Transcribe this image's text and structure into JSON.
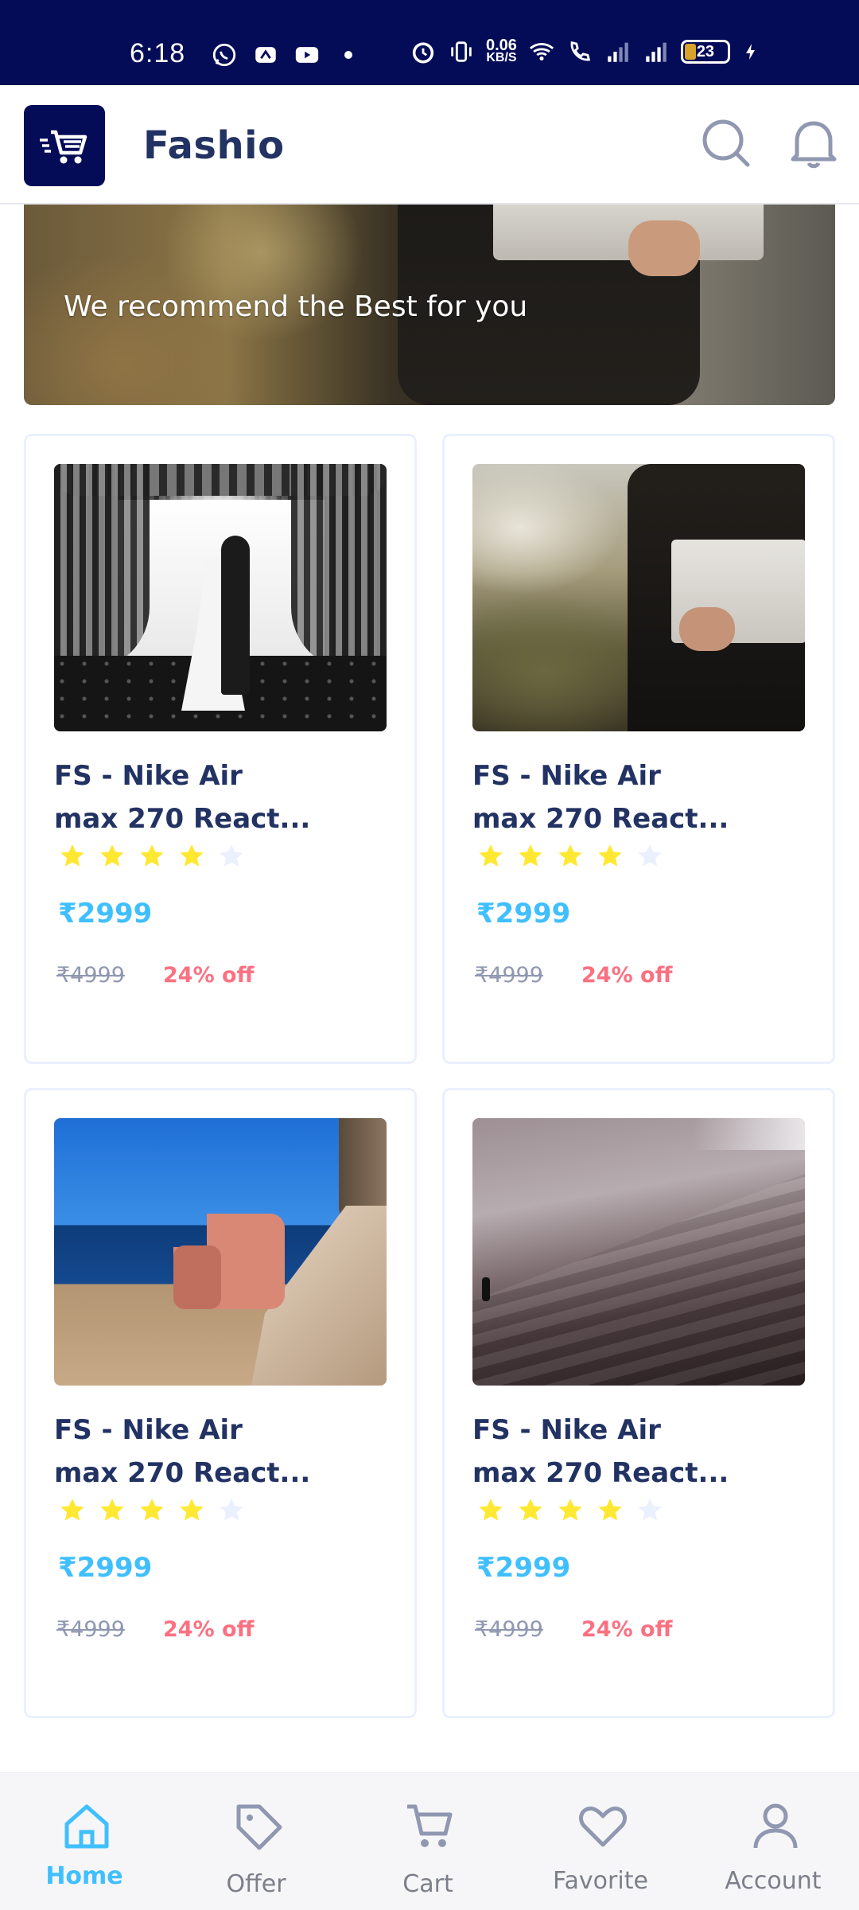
{
  "status_bar": {
    "time": "6:18",
    "net_speed_value": "0.06",
    "net_speed_unit": "KB/S",
    "battery_level": "23",
    "icons": [
      "whatsapp-icon",
      "app-icon",
      "youtube-icon",
      "dot-icon",
      "alarm-icon",
      "vibrate-icon",
      "wifi-icon",
      "call-icon",
      "signal-icon",
      "signal-icon",
      "battery-icon",
      "charging-icon"
    ]
  },
  "header": {
    "title": "Fashio",
    "logo_icon": "shopping-cart-icon",
    "search_icon": "search-icon",
    "notification_icon": "bell-icon"
  },
  "banner": {
    "text": "We recommend the Best for you"
  },
  "products": [
    {
      "name_line1": "FS - Nike Air",
      "name_line2": "max 270 React...",
      "rating": 4,
      "max_rating": 5,
      "price": "₹2999",
      "old_price": "₹4999",
      "discount": "24% off",
      "image": "wedding-couple-photo"
    },
    {
      "name_line1": "FS - Nike Air",
      "name_line2": "max 270 React...",
      "rating": 4,
      "max_rating": 5,
      "price": "₹2999",
      "old_price": "₹4999",
      "discount": "24% off",
      "image": "man-holding-laptop-photo"
    },
    {
      "name_line1": "FS - Nike Air",
      "name_line2": "max 270 React...",
      "rating": 4,
      "max_rating": 5,
      "price": "₹2999",
      "old_price": "₹4999",
      "discount": "24% off",
      "image": "armchair-by-sea-photo"
    },
    {
      "name_line1": "FS - Nike Air",
      "name_line2": "max 270 React...",
      "rating": 4,
      "max_rating": 5,
      "price": "₹2999",
      "old_price": "₹4999",
      "discount": "24% off",
      "image": "misty-mountain-photo"
    }
  ],
  "bottom_nav": [
    {
      "label": "Home",
      "icon": "home-icon",
      "active": true
    },
    {
      "label": "Offer",
      "icon": "tag-icon",
      "active": false
    },
    {
      "label": "Cart",
      "icon": "cart-icon",
      "active": false
    },
    {
      "label": "Favorite",
      "icon": "heart-icon",
      "active": false
    },
    {
      "label": "Account",
      "icon": "user-icon",
      "active": false
    }
  ],
  "colors": {
    "status_bar": "#050c57",
    "title": "#223263",
    "price": "#40bfff",
    "discount": "#fb7181",
    "old_price": "#9098b1",
    "star_filled": "#ffe832",
    "star_empty": "#ebf0ff",
    "nav_active": "#40bfff",
    "nav_inactive": "#7c7f8a"
  }
}
